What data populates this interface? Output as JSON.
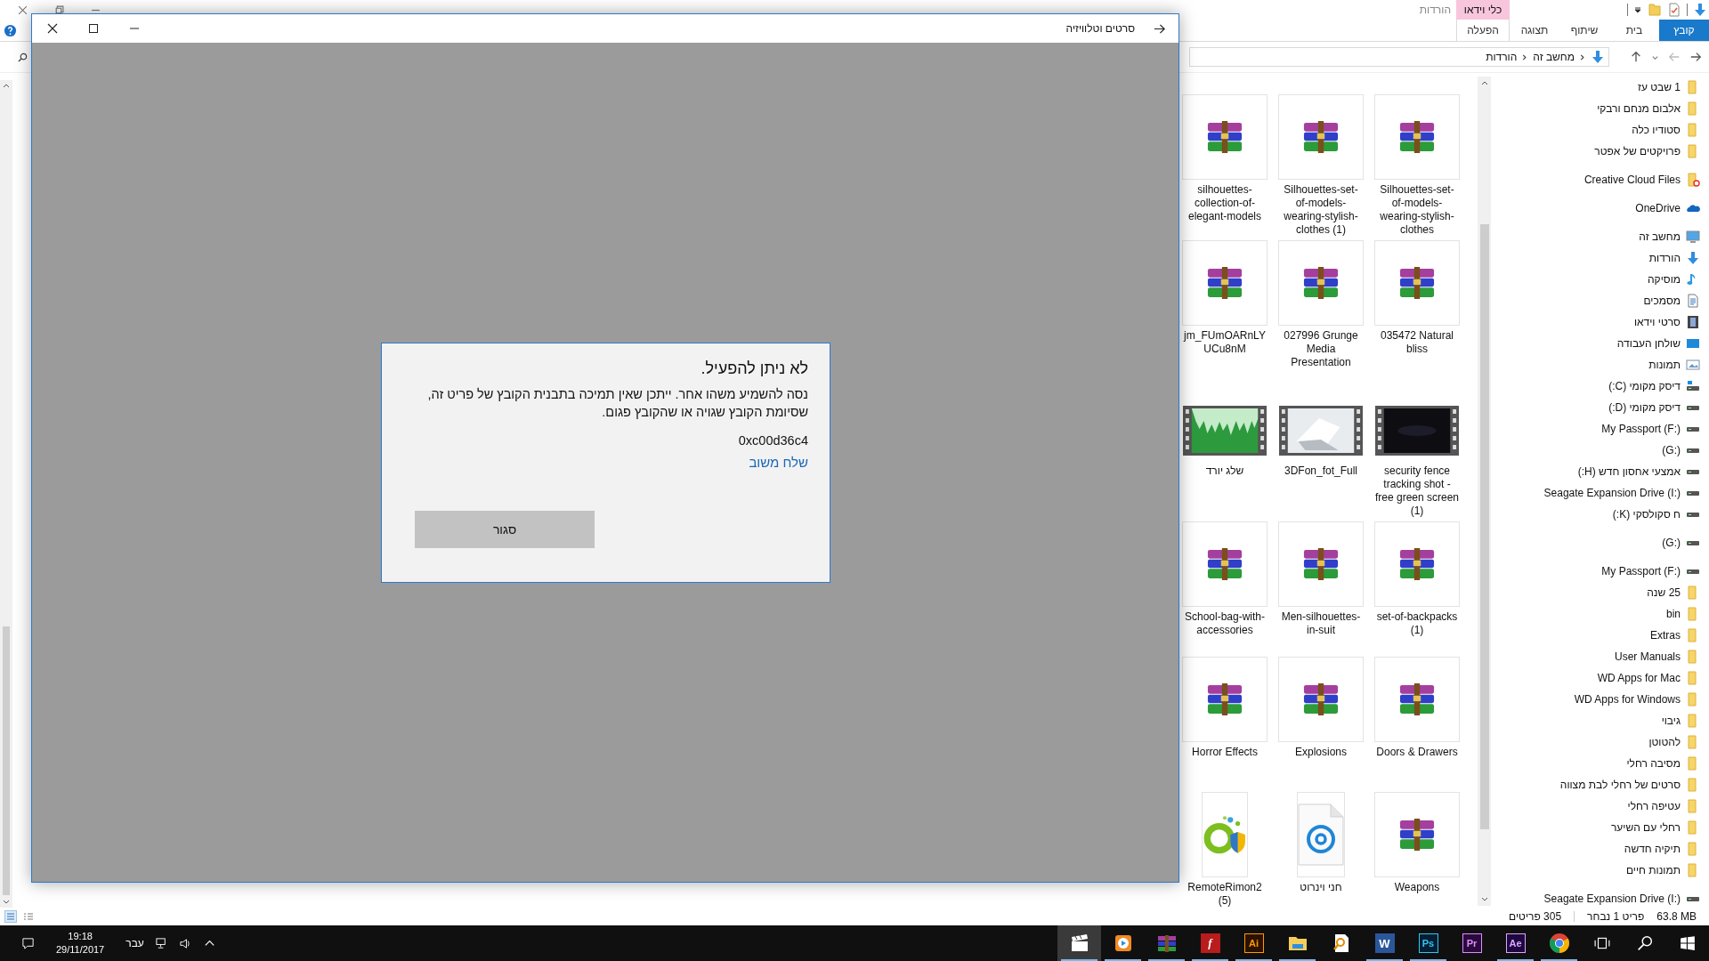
{
  "explorer": {
    "title": "הורדות",
    "ribbon_tabs": [
      {
        "label": "קובץ",
        "selected": true
      },
      {
        "label": "בית",
        "selected": false
      },
      {
        "label": "שיתוף",
        "selected": false
      },
      {
        "label": "תצוגה",
        "selected": false
      },
      {
        "label": "הפעלה",
        "selected": false,
        "group": "כלי וידאו"
      }
    ],
    "breadcrumb": [
      "מחשב זה",
      "הורדות"
    ],
    "files": [
      {
        "name": "Silhouettes-set-of-models-wearing-stylish-clothes",
        "kind": "archive"
      },
      {
        "name": "Silhouettes-set-of-models-wearing-stylish-clothes (1)",
        "kind": "archive"
      },
      {
        "name": "silhouettes-collection-of-elegant-models",
        "kind": "archive"
      },
      {
        "name": "035472 Natural bliss",
        "kind": "archive"
      },
      {
        "name": "027996 Grunge Media Presentation",
        "kind": "archive"
      },
      {
        "name": "jm_FUmOARnLYUCu8nM",
        "kind": "archive"
      },
      {
        "name": "security fence tracking shot - free green screen (1)",
        "kind": "video"
      },
      {
        "name": "3DFon_fot_Full",
        "kind": "video"
      },
      {
        "name": "שלג יורד",
        "kind": "video"
      },
      {
        "name": "set-of-backpacks (1)",
        "kind": "archive"
      },
      {
        "name": "Men-silhouettes-in-suit",
        "kind": "archive"
      },
      {
        "name": "School-bag-with-accessories",
        "kind": "archive"
      },
      {
        "name": "Doors & Drawers",
        "kind": "archive"
      },
      {
        "name": "Explosions",
        "kind": "archive"
      },
      {
        "name": "Horror Effects",
        "kind": "archive"
      },
      {
        "name": "Weapons",
        "kind": "archive"
      },
      {
        "name": "חני וינרוט",
        "kind": "doc"
      },
      {
        "name": "RemoteRimon2 (5)",
        "kind": "app"
      }
    ],
    "nav_groups": [
      {
        "items": [
          {
            "label": "1 שבט עז",
            "kind": "folder"
          },
          {
            "label": "אלבום מנחם ורבקי",
            "kind": "folder"
          },
          {
            "label": "סטודיו כלה",
            "kind": "folder"
          },
          {
            "label": "פרויקטים של אפטר",
            "kind": "folder"
          }
        ]
      },
      {
        "items": [
          {
            "label": "Creative Cloud Files",
            "kind": "cc"
          }
        ]
      },
      {
        "items": [
          {
            "label": "OneDrive",
            "kind": "onedrive"
          }
        ]
      },
      {
        "items": [
          {
            "label": "מחשב זה",
            "kind": "pc"
          },
          {
            "label": "הורדות",
            "kind": "download"
          },
          {
            "label": "מוסיקה",
            "kind": "music"
          },
          {
            "label": "מסמכים",
            "kind": "docs"
          },
          {
            "label": "סרטי וידאו",
            "kind": "video"
          },
          {
            "label": "שולחן העבודה",
            "kind": "desktop"
          },
          {
            "label": "תמונות",
            "kind": "pictures"
          },
          {
            "label": "דיסק מקומי (C:)",
            "kind": "sysdrive"
          },
          {
            "label": "דיסק מקומי (D:)",
            "kind": "drive"
          },
          {
            "label": "My Passport (F:)",
            "kind": "drive"
          },
          {
            "label": "(G:)",
            "kind": "drive"
          },
          {
            "label": "אמצעי אחסון חדש (H:)",
            "kind": "drive"
          },
          {
            "label": "Seagate Expansion Drive (I:)",
            "kind": "drive"
          },
          {
            "label": "ח סקולסקי (K:)",
            "kind": "drive"
          }
        ]
      },
      {
        "items": [
          {
            "label": "(G:)",
            "kind": "drive"
          }
        ]
      },
      {
        "items": [
          {
            "label": "My Passport (F:)",
            "kind": "drive",
            "children": [
              {
                "label": "25 שנה",
                "kind": "folder"
              },
              {
                "label": "bin",
                "kind": "folder"
              },
              {
                "label": "Extras",
                "kind": "folder"
              },
              {
                "label": "User Manuals",
                "kind": "folder"
              },
              {
                "label": "WD Apps for Mac",
                "kind": "folder"
              },
              {
                "label": "WD Apps for Windows",
                "kind": "folder"
              },
              {
                "label": "גיבוי",
                "kind": "folder"
              },
              {
                "label": "להטוטן",
                "kind": "folder"
              },
              {
                "label": "מסיבה רחלי",
                "kind": "folder"
              },
              {
                "label": "סרטים של רחלי לבת מצווה",
                "kind": "folder"
              },
              {
                "label": "עטיפה רחלי",
                "kind": "folder"
              },
              {
                "label": "רחלי עם השיער",
                "kind": "folder"
              },
              {
                "label": "תיקיה חדשה",
                "kind": "folder"
              },
              {
                "label": "תמונות חיים",
                "kind": "folder"
              }
            ]
          }
        ]
      },
      {
        "items": [
          {
            "label": "Seagate Expansion Drive (I:)",
            "kind": "drive"
          }
        ]
      }
    ],
    "status": {
      "count": "305 פריטים",
      "selected": "פריט 1 נבחר",
      "size": "63.8 MB"
    }
  },
  "player": {
    "title": "סרטים וטלוויזיה",
    "dialog": {
      "title": "לא ניתן להפעיל.",
      "message": "נסה להשמיע משהו אחר. ייתכן שאין תמיכה בתבנית הקובץ של פריט זה, שסיומת הקובץ שגויה או שהקובץ פגום.",
      "code": "0xc00d36c4",
      "link": "שלח משוב",
      "button": "סגור"
    }
  },
  "taskbar": {
    "apps": [
      {
        "kind": "chrome",
        "running": true
      },
      {
        "kind": "ae",
        "label": "Ae",
        "running": true
      },
      {
        "kind": "pr",
        "label": "Pr",
        "running": false
      },
      {
        "kind": "ps",
        "label": "Ps",
        "running": true
      },
      {
        "kind": "word",
        "label": "W",
        "running": true
      },
      {
        "kind": "search-doc",
        "running": false
      },
      {
        "kind": "explorer",
        "running": true
      },
      {
        "kind": "ai",
        "label": "Ai",
        "running": true
      },
      {
        "kind": "flash",
        "label": "f",
        "running": true
      },
      {
        "kind": "archive",
        "running": true
      },
      {
        "kind": "media",
        "running": true
      },
      {
        "kind": "clapper",
        "running": true
      }
    ],
    "language": "עבר",
    "time": "19:18",
    "date": "29/11/2017"
  }
}
